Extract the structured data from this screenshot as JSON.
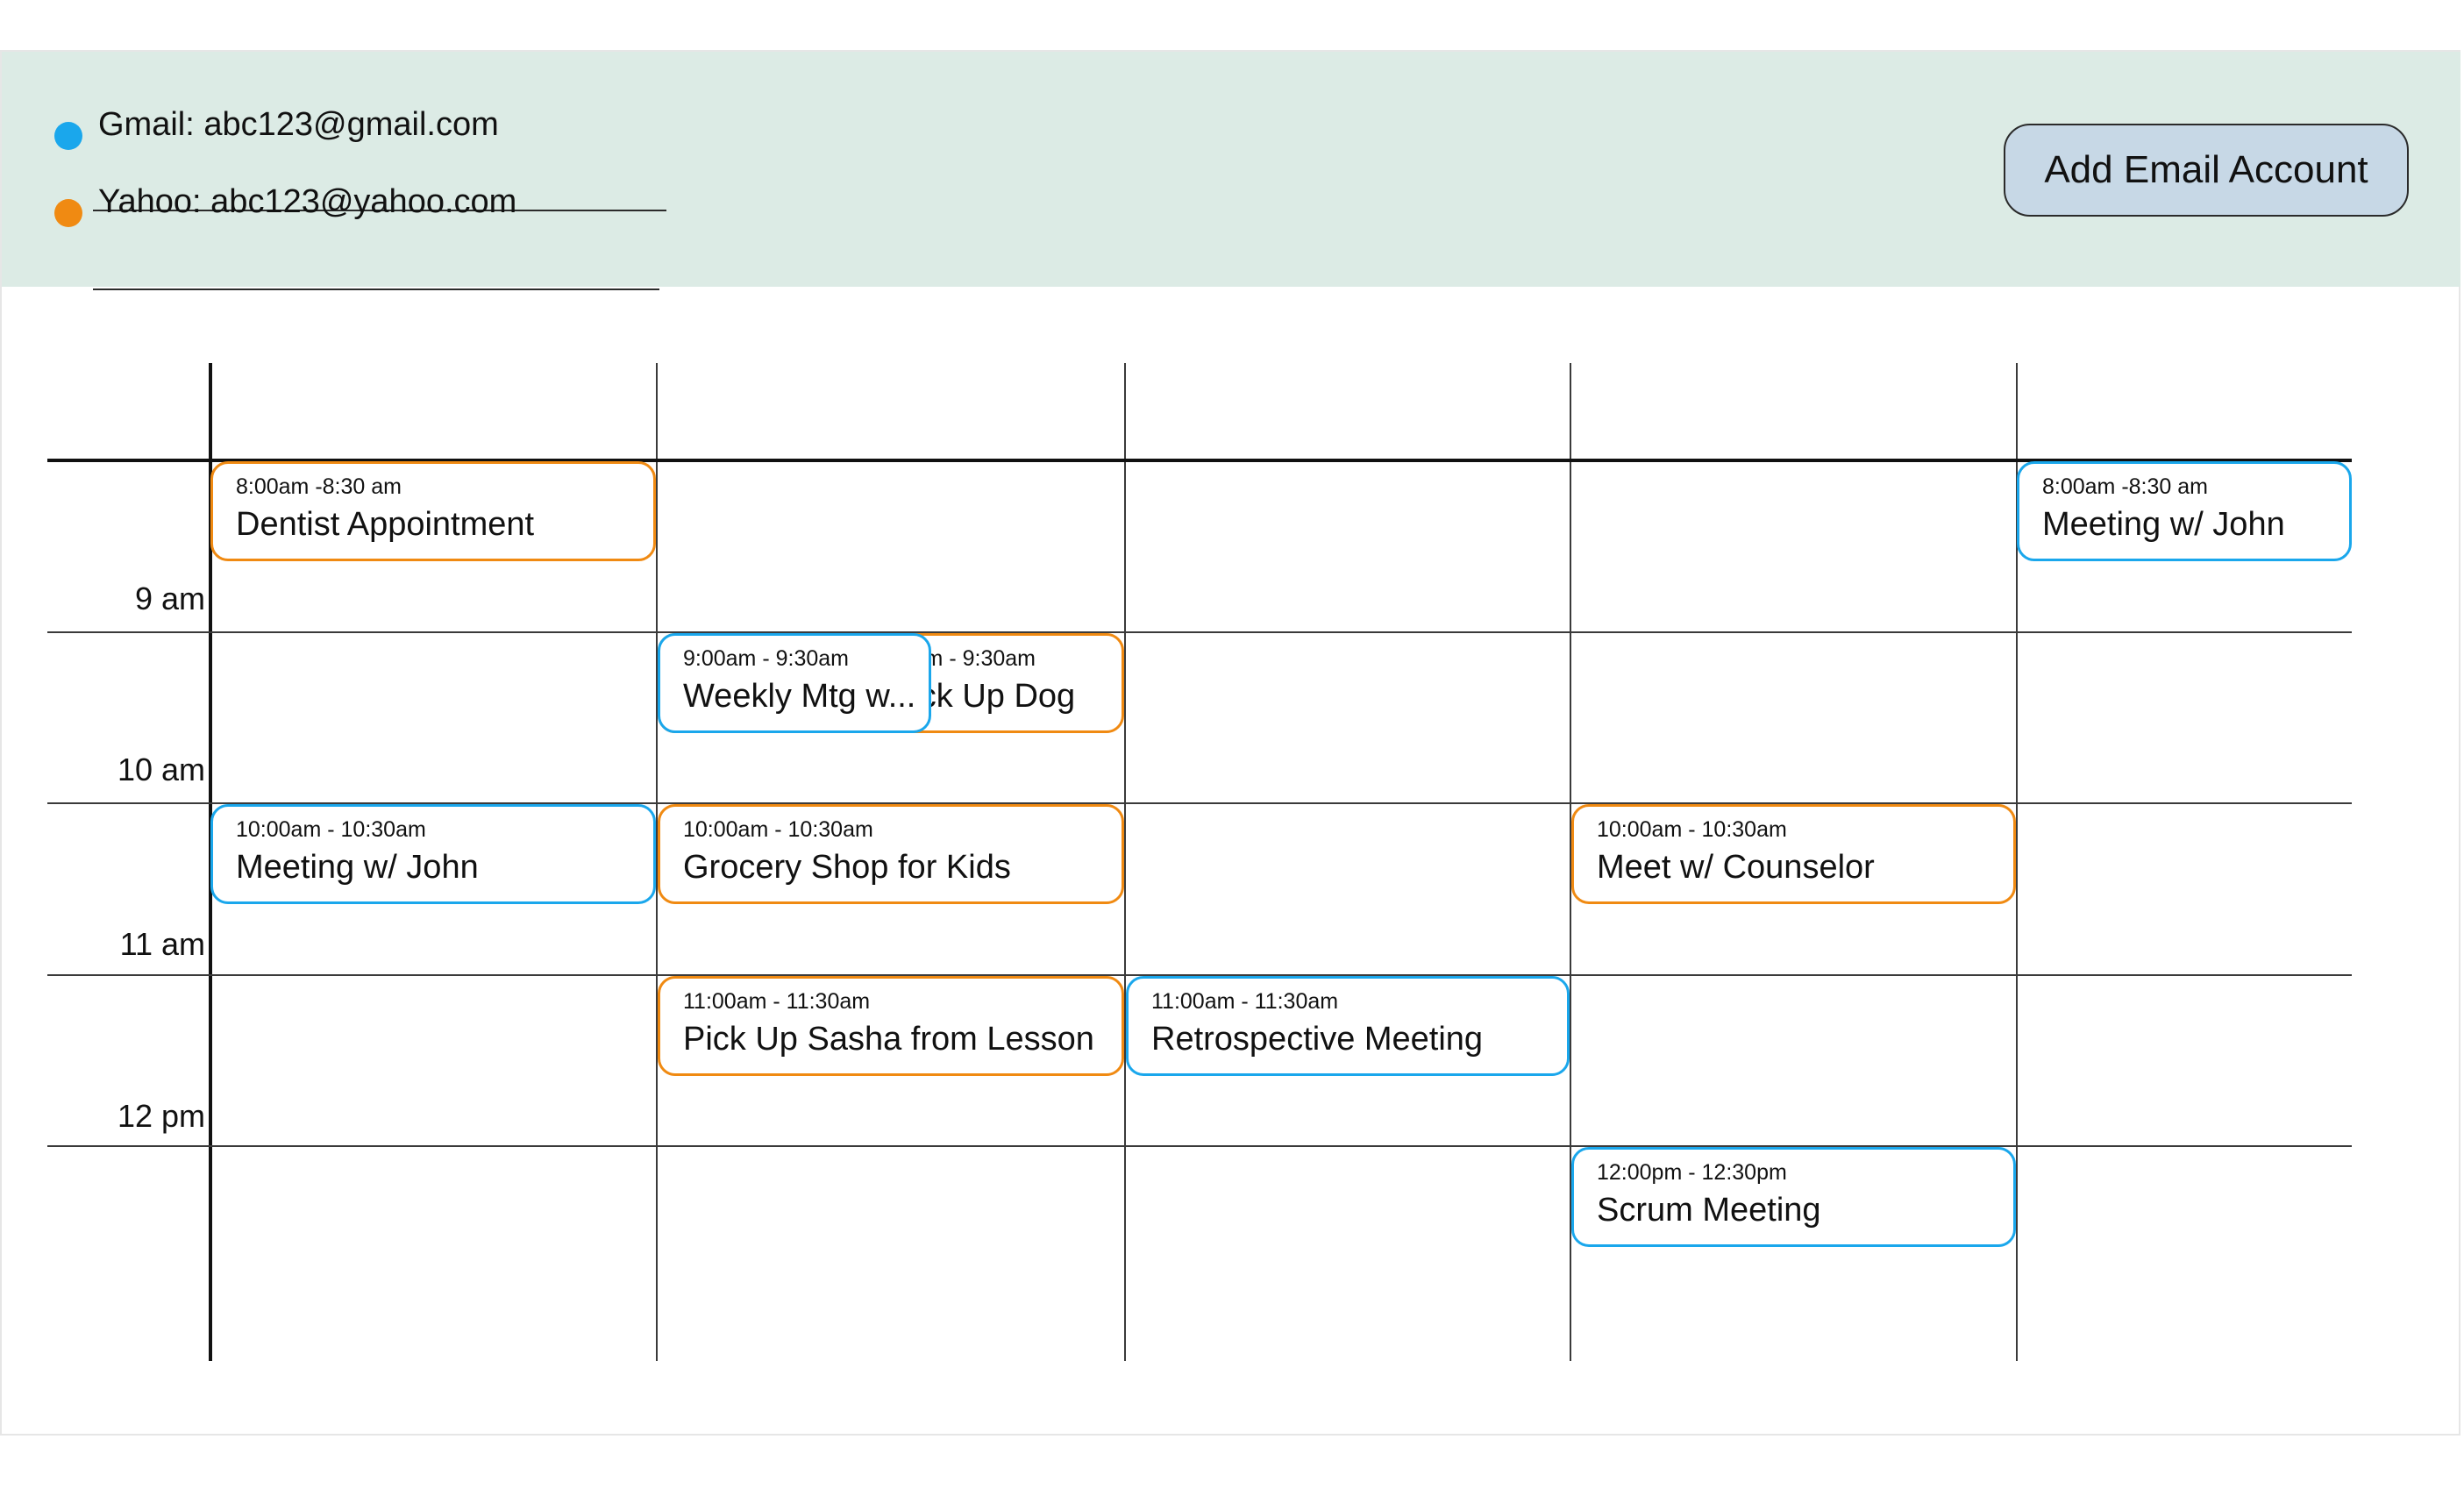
{
  "accounts": [
    {
      "label": "Gmail: abc123@gmail.com",
      "color": "#1aa7ec"
    },
    {
      "label": "Yahoo: abc123@yahoo.com",
      "color": "#f08a12"
    }
  ],
  "add_account_label": "Add Email Account",
  "hours": [
    "9 am",
    "10 am",
    "11 am",
    "12 pm"
  ],
  "colors": {
    "gmail": "#1aa7ec",
    "yahoo": "#f08a12",
    "header_bg": "#dcebe5",
    "button_bg": "#c7d8e6"
  },
  "events": [
    {
      "time": "8:00am -8:30 am",
      "title": "Dentist Appointment",
      "account": "yahoo"
    },
    {
      "time": "8:00am -8:30 am",
      "title": "Meeting w/ John",
      "account": "gmail"
    },
    {
      "time": "9:00am - 9:30am",
      "title": "Pick Up Dog",
      "account": "yahoo"
    },
    {
      "time": "9:00am - 9:30am",
      "title": "Weekly Mtg w...",
      "account": "gmail"
    },
    {
      "time": "10:00am - 10:30am",
      "title": "Meeting w/ John",
      "account": "gmail"
    },
    {
      "time": "10:00am - 10:30am",
      "title": "Grocery Shop for Kids",
      "account": "yahoo"
    },
    {
      "time": "10:00am - 10:30am",
      "title": "Meet w/ Counselor",
      "account": "yahoo"
    },
    {
      "time": "11:00am - 11:30am",
      "title": "Pick Up Sasha from Lesson",
      "account": "yahoo"
    },
    {
      "time": "11:00am - 11:30am",
      "title": "Retrospective Meeting",
      "account": "gmail"
    },
    {
      "time": "12:00pm - 12:30pm",
      "title": "Scrum Meeting",
      "account": "gmail"
    }
  ]
}
